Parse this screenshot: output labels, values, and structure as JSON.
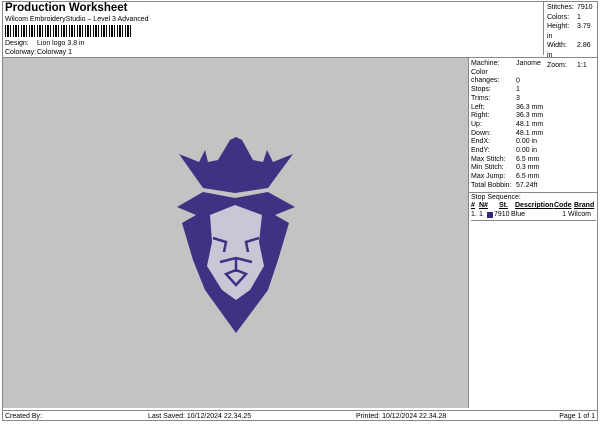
{
  "header": {
    "title": "Production Worksheet",
    "subtitle": "Wilcom EmbroideryStudio – Level 3 Advanced",
    "design_label": "Design:",
    "design_value": "Lion logo 3.8 in",
    "colorway_label": "Colorway:",
    "colorway_value": "Colorway 1"
  },
  "stats": [
    {
      "k": "Stitches:",
      "v": "7910"
    },
    {
      "k": "Colors:",
      "v": "1"
    },
    {
      "k": "Height:",
      "v": "3.79 in"
    },
    {
      "k": "Width:",
      "v": "2.86 in"
    },
    {
      "k": "Zoom:",
      "v": "1:1"
    }
  ],
  "info": [
    {
      "k": "Machine:",
      "v": "Janome"
    },
    {
      "k": "Color changes:",
      "v": "0"
    },
    {
      "k": "Stops:",
      "v": "1"
    },
    {
      "k": "Trims:",
      "v": "3"
    },
    {
      "k": "Left:",
      "v": "36.3 mm"
    },
    {
      "k": "Right:",
      "v": "36.3 mm"
    },
    {
      "k": "Up:",
      "v": "48.1 mm"
    },
    {
      "k": "Down:",
      "v": "48.1 mm"
    },
    {
      "k": "EndX:",
      "v": "0.00 in"
    },
    {
      "k": "EndY:",
      "v": "0.00 in"
    },
    {
      "k": "Max Stitch:",
      "v": "6.5 mm"
    },
    {
      "k": "Min Stitch:",
      "v": "0.3 mm"
    },
    {
      "k": "Max Jump:",
      "v": "6.5 mm"
    },
    {
      "k": "Total Bobbin:",
      "v": "57.24ft"
    }
  ],
  "sequence": {
    "title": "Stop Sequence:",
    "headers": [
      "#",
      "N#",
      "St.",
      "Description",
      "Code",
      "Brand"
    ],
    "rows": [
      {
        "num": "1.",
        "n": "1",
        "st": "7910",
        "desc": "Blue",
        "code": "1",
        "brand": "Wilcom",
        "color": "#2e2a7a"
      }
    ]
  },
  "footer": {
    "created": "Created By:",
    "saved": "Last Saved: 10/12/2024 22.34.25",
    "printed": "Printed: 10/12/2024 22.34.28",
    "page": "Page 1 of 1"
  },
  "colors": {
    "thread": "#3d3382"
  }
}
